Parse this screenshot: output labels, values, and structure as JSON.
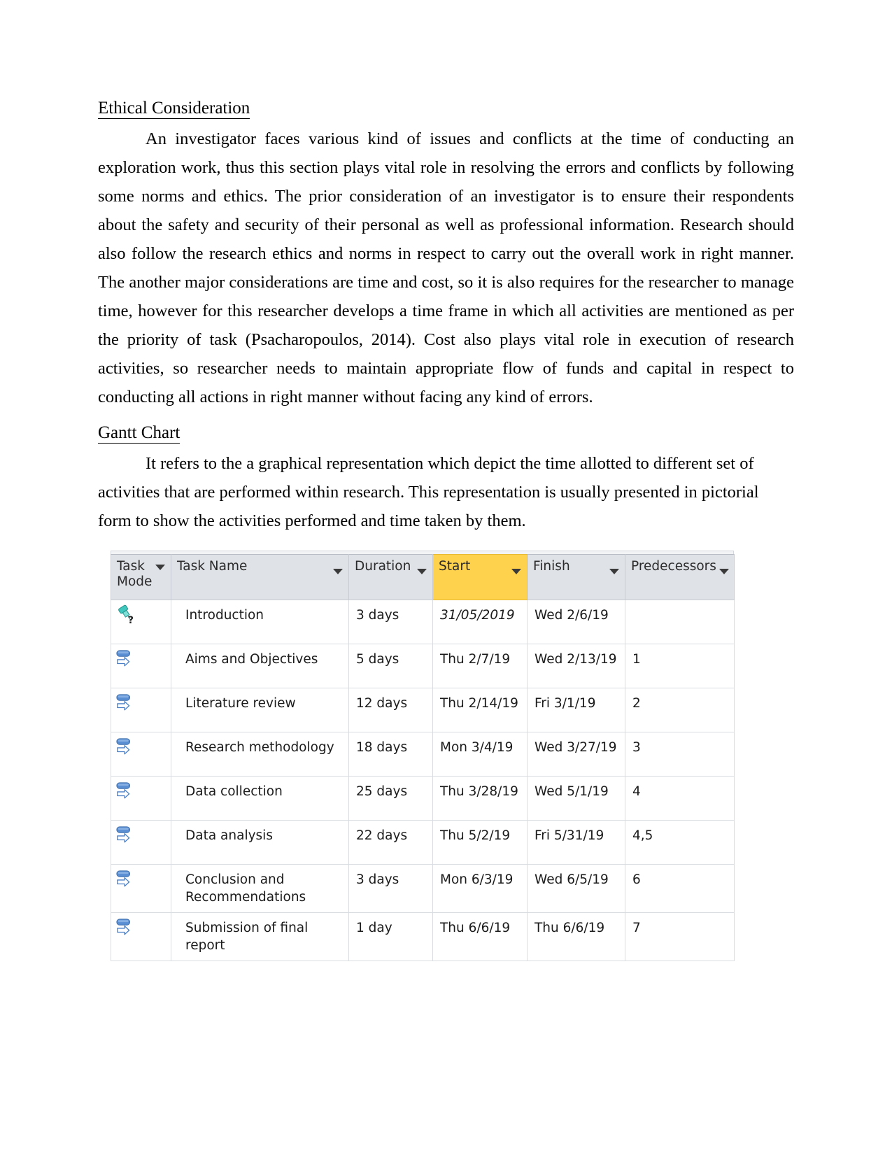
{
  "document": {
    "sections": [
      {
        "heading": "Ethical Consideration ",
        "paragraphs": [
          "An investigator faces various kind of issues and conflicts at the time of conducting an exploration work, thus this section plays vital role in resolving the errors and conflicts by following some norms and ethics. The prior consideration of an investigator is to ensure their respondents about the safety and security of their personal as well as professional information. Research should also follow the research ethics and norms in respect to carry out the overall work in right manner. The another major considerations are time and cost, so it is also requires for the researcher to manage time, however for this researcher develops a time frame in which all activities are mentioned as per the priority of task (Psacharopoulos, 2014). Cost also plays vital role in execution of research activities, so researcher needs to maintain appropriate flow of funds and capital in respect to conducting all actions in right manner without facing any kind of errors."
        ]
      },
      {
        "heading": "Gantt Chart ",
        "paragraphs": [
          "It refers to the a graphical representation  which depict the time allotted to different set of activities that are performed within research. This representation is usually presented in pictorial form to show the activities performed and time taken by them."
        ]
      }
    ]
  },
  "gantt_table": {
    "columns": [
      {
        "label": "Task\nMode",
        "key": "task_mode",
        "highlight": false,
        "has_filter": true
      },
      {
        "label": "Task Name",
        "key": "task_name",
        "highlight": false,
        "has_filter": true
      },
      {
        "label": "Duration",
        "key": "duration",
        "highlight": false,
        "has_filter": true
      },
      {
        "label": "Start",
        "key": "start",
        "highlight": true,
        "has_filter": true
      },
      {
        "label": "Finish",
        "key": "finish",
        "highlight": true,
        "has_filter": true
      },
      {
        "label": "Predecessors",
        "key": "predecessors",
        "highlight": false,
        "has_filter": true
      }
    ],
    "highlight_color": "#ffd24d",
    "header_color": "#dfe2e7",
    "manual_start_color": "#3f9e9e",
    "rows": [
      {
        "mode_icon": "pushpin-question-icon",
        "task_name": "Introduction",
        "duration": "3 days",
        "start": "31/05/2019",
        "start_style": "manual",
        "finish": "Wed 2/6/19",
        "predecessors": ""
      },
      {
        "mode_icon": "auto-schedule-icon",
        "task_name": "Aims and Objectives",
        "duration": "5 days",
        "start": "Thu 2/7/19",
        "start_style": "normal",
        "finish": "Wed 2/13/19",
        "predecessors": "1"
      },
      {
        "mode_icon": "auto-schedule-icon",
        "task_name": "Literature review",
        "duration": "12 days",
        "start": "Thu 2/14/19",
        "start_style": "normal",
        "finish": "Fri 3/1/19",
        "predecessors": "2"
      },
      {
        "mode_icon": "auto-schedule-icon",
        "task_name": "Research methodology",
        "duration": "18 days",
        "start": "Mon 3/4/19",
        "start_style": "normal",
        "finish": "Wed 3/27/19",
        "predecessors": "3"
      },
      {
        "mode_icon": "auto-schedule-icon",
        "task_name": "Data collection",
        "duration": "25 days",
        "start": "Thu 3/28/19",
        "start_style": "normal",
        "finish": "Wed 5/1/19",
        "predecessors": "4"
      },
      {
        "mode_icon": "auto-schedule-icon",
        "task_name": "Data analysis",
        "duration": "22 days",
        "start": "Thu 5/2/19",
        "start_style": "normal",
        "finish": "Fri 5/31/19",
        "predecessors": "4,5"
      },
      {
        "mode_icon": "auto-schedule-icon",
        "task_name": "Conclusion and Recommendations",
        "duration": "3 days",
        "start": "Mon 6/3/19",
        "start_style": "normal",
        "finish": "Wed 6/5/19",
        "predecessors": "6"
      },
      {
        "mode_icon": "auto-schedule-icon",
        "task_name": "Submission of final report",
        "duration": "1 day",
        "start": "Thu 6/6/19",
        "start_style": "normal",
        "finish": "Thu 6/6/19",
        "predecessors": "7"
      }
    ]
  }
}
